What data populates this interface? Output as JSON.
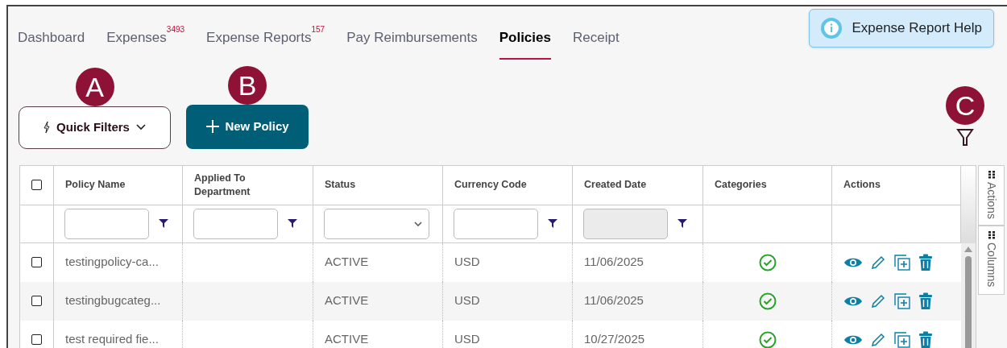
{
  "tabs": [
    {
      "label": "Dashboard",
      "selected": false
    },
    {
      "label": "Expenses",
      "badge": "3493",
      "selected": false
    },
    {
      "label": "Expense Reports",
      "badge": "157",
      "selected": false
    },
    {
      "label": "Pay Reimbursements",
      "selected": false
    },
    {
      "label": "Policies",
      "selected": true
    },
    {
      "label": "Receipt",
      "selected": false
    }
  ],
  "help_button": "Expense Report Help",
  "callouts": [
    "A",
    "B",
    "C"
  ],
  "quick_filters": "Quick Filters",
  "new_policy": "New Policy",
  "table": {
    "select_all_checked": false,
    "columns": [
      {
        "label": "Policy Name",
        "kind": "text"
      },
      {
        "label": "Applied To Department",
        "kind": "text"
      },
      {
        "label": "Status",
        "kind": "select"
      },
      {
        "label": "Currency Code",
        "kind": "text"
      },
      {
        "label": "Created Date",
        "kind": "date"
      },
      {
        "label": "Categories",
        "kind": "plain"
      },
      {
        "label": "Actions",
        "kind": "plain"
      }
    ],
    "rows": [
      {
        "checked": false,
        "policy_name": "testingpolicy-ca...",
        "status": "ACTIVE",
        "currency": "USD",
        "created": "11/06/2025",
        "categories": true
      },
      {
        "checked": false,
        "policy_name": "testingbugcateg...",
        "status": "ACTIVE",
        "currency": "USD",
        "created": "11/06/2025",
        "categories": true
      },
      {
        "checked": false,
        "policy_name": "test required fie...",
        "status": "ACTIVE",
        "currency": "USD",
        "created": "10/27/2025",
        "categories": true
      }
    ]
  },
  "side_panels": [
    "Actions",
    "Columns"
  ]
}
